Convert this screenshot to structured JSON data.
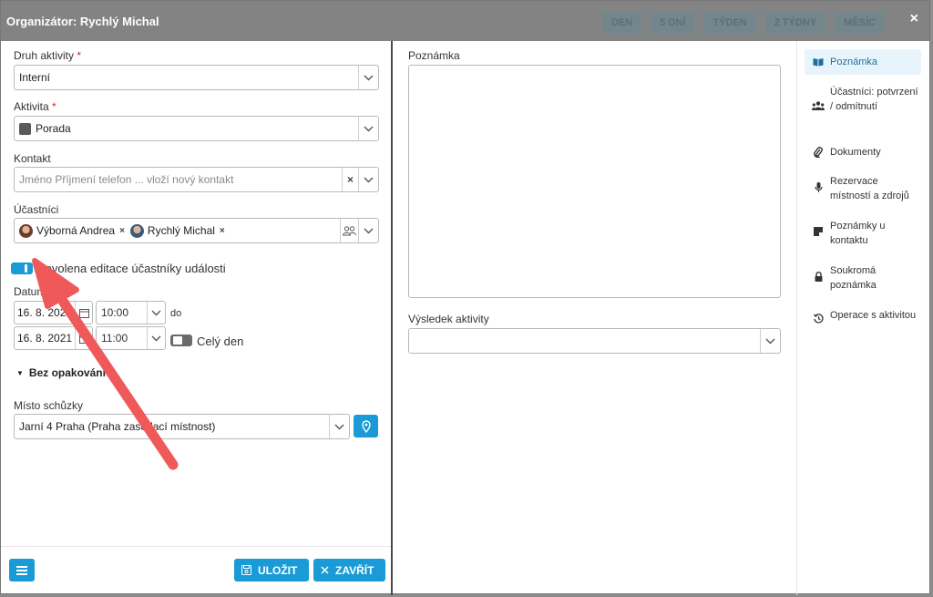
{
  "header": {
    "title": "Organizátor: Rychlý Michal",
    "close_icon": "×",
    "background_views": [
      "DEN",
      "5 DNÍ",
      "TÝDEN",
      "2 TÝDNY",
      "MĚSÍC"
    ]
  },
  "form": {
    "activity_type": {
      "label": "Druh aktivity",
      "required_mark": "*",
      "value": "Interní"
    },
    "activity": {
      "label": "Aktivita",
      "required_mark": "*",
      "value": "Porada",
      "swatch_color": "#5a5a5a"
    },
    "contact": {
      "label": "Kontakt",
      "placeholder": "Jméno Příjmení telefon ... vloží nový kontakt",
      "clear": "×"
    },
    "participants": {
      "label": "Účastníci",
      "items": [
        {
          "name": "Výborná Andrea",
          "remove": "×"
        },
        {
          "name": "Rychlý Michal",
          "remove": "×"
        }
      ]
    },
    "edit_toggle": {
      "label": "Povolena editace účastníky události",
      "on": true
    },
    "date": {
      "label": "Datum",
      "start_date": "16. 8. 2021",
      "start_time": "10:00",
      "to_label": "do",
      "end_date": "16. 8. 2021",
      "end_time": "11:00",
      "all_day_label": "Celý den",
      "all_day": false
    },
    "repeat": {
      "label": "Bez opakování"
    },
    "location": {
      "label": "Místo schůzky",
      "value": "Jarní 4 Praha (Praha zasedací místnost)"
    }
  },
  "buttons": {
    "save": "ULOŽIT",
    "close": "ZAVŘÍT"
  },
  "middle": {
    "note_label": "Poznámka",
    "result_label": "Výsledek aktivity"
  },
  "sidebar": {
    "items": [
      {
        "label": "Poznámka",
        "icon": "book-icon",
        "active": true
      },
      {
        "label": "Účastníci: potvrzení / odmítnutí",
        "icon": "users-icon"
      },
      {
        "label": "Dokumenty",
        "icon": "paperclip-icon"
      },
      {
        "label": "Rezervace místností a zdrojů",
        "icon": "microphone-icon"
      },
      {
        "label": "Poznámky u kontaktu",
        "icon": "sticky-note-icon"
      },
      {
        "label": "Soukromá poznámka",
        "icon": "lock-icon"
      },
      {
        "label": "Operace s aktivitou",
        "icon": "history-icon"
      }
    ]
  },
  "colors": {
    "accent": "#1a9ad6",
    "arrow": "#f0595a"
  }
}
